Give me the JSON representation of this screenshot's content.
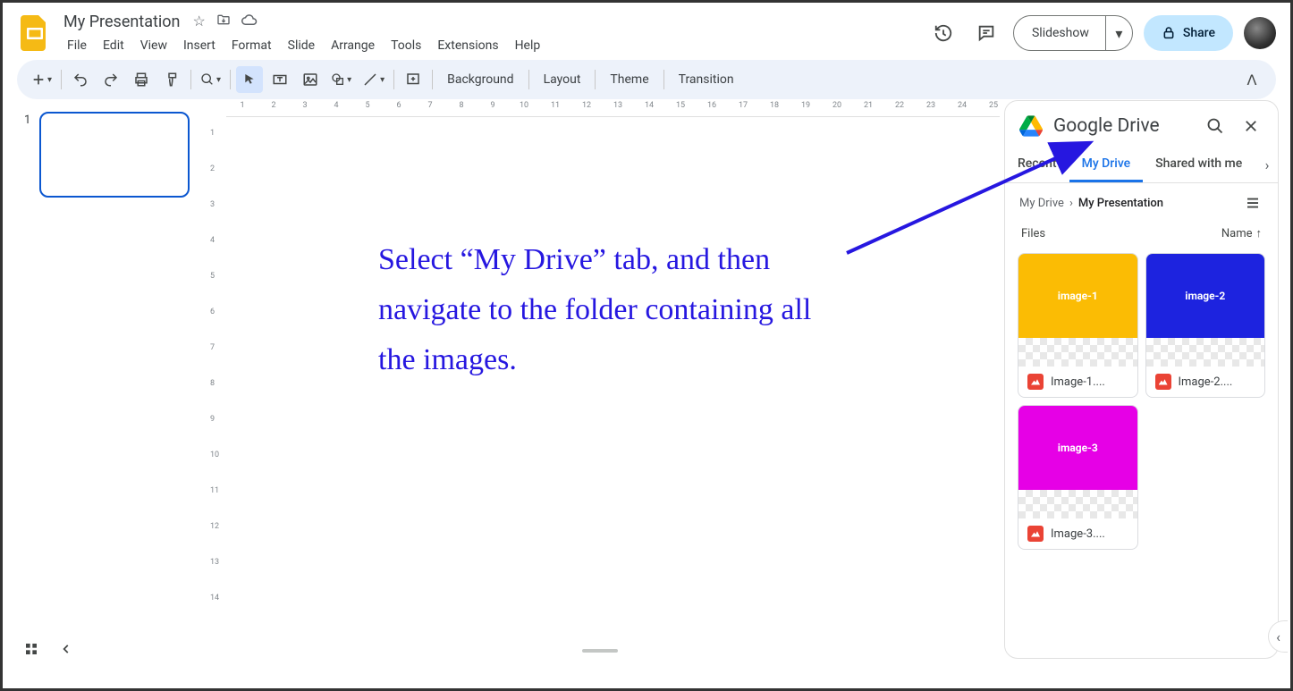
{
  "doc": {
    "title": "My Presentation"
  },
  "menus": [
    "File",
    "Edit",
    "View",
    "Insert",
    "Format",
    "Slide",
    "Arrange",
    "Tools",
    "Extensions",
    "Help"
  ],
  "toolbar": {
    "background": "Background",
    "layout": "Layout",
    "theme": "Theme",
    "transition": "Transition"
  },
  "topbar": {
    "slideshow": "Slideshow",
    "share": "Share"
  },
  "filmstrip": {
    "slide1_num": "1"
  },
  "annotation_text": "Select “My Drive” tab, and then navigate to the folder containing all the images.",
  "drive": {
    "title": "Google Drive",
    "tabs": {
      "recent": "Recent",
      "mydrive": "My Drive",
      "shared": "Shared with me"
    },
    "crumbs": {
      "root": "My Drive",
      "current": "My Presentation"
    },
    "sort": {
      "files_label": "Files",
      "name_label": "Name"
    },
    "files": [
      {
        "label": "Image-1....",
        "preview_text": "image-1",
        "color": "#fbbc04"
      },
      {
        "label": "Image-2....",
        "preview_text": "image-2",
        "color": "#1d23df"
      },
      {
        "label": "Image-3....",
        "preview_text": "image-3",
        "color": "#e600e6"
      }
    ]
  },
  "ruler_h": [
    1,
    2,
    3,
    4,
    5,
    6,
    7,
    8,
    9,
    10,
    11,
    12,
    13,
    14,
    15,
    16,
    17,
    18,
    19,
    20,
    21,
    22,
    23,
    24,
    25
  ],
  "ruler_v": [
    1,
    2,
    3,
    4,
    5,
    6,
    7,
    8,
    9,
    10,
    11,
    12,
    13,
    14
  ]
}
